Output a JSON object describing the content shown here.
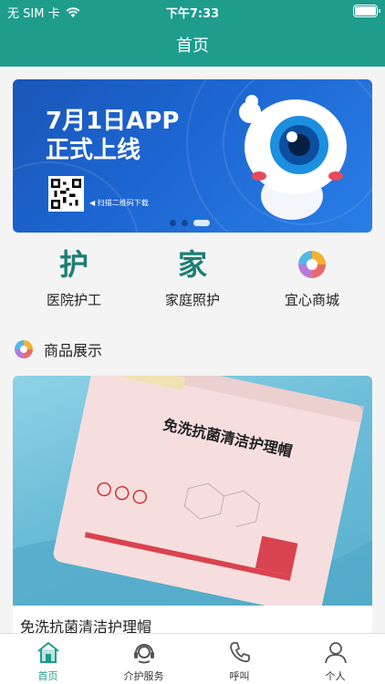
{
  "status_bar": {
    "carrier": "无 SIM 卡",
    "time": "下午7:33"
  },
  "header": {
    "title": "首页"
  },
  "banner": {
    "headline_line1": "7月1日APP",
    "headline_line2": "正式上线",
    "scan_text": "◀ 扫描二维码下载",
    "page_count": 3,
    "active_page": 3
  },
  "services": [
    {
      "glyph": "护",
      "label": "医院护工",
      "icon": "hospital-care-icon"
    },
    {
      "glyph": "家",
      "label": "家庭照护",
      "icon": "home-care-icon"
    },
    {
      "glyph": "",
      "label": "宜心商城",
      "icon": "mall-logo-icon"
    }
  ],
  "section": {
    "title": "商品展示"
  },
  "product": {
    "name": "免洗抗菌清洁护理帽",
    "package_text": "免洗抗菌清洁护理帽"
  },
  "tabbar": [
    {
      "label": "首页",
      "active": true,
      "icon": "home-icon"
    },
    {
      "label": "介护服务",
      "active": false,
      "icon": "headset-icon"
    },
    {
      "label": "呼叫",
      "active": false,
      "icon": "phone-icon"
    },
    {
      "label": "个人",
      "active": false,
      "icon": "user-icon"
    }
  ],
  "colors": {
    "primary": "#1e9c8c",
    "glyph": "#1b7f73",
    "banner": "#1d66d2"
  }
}
